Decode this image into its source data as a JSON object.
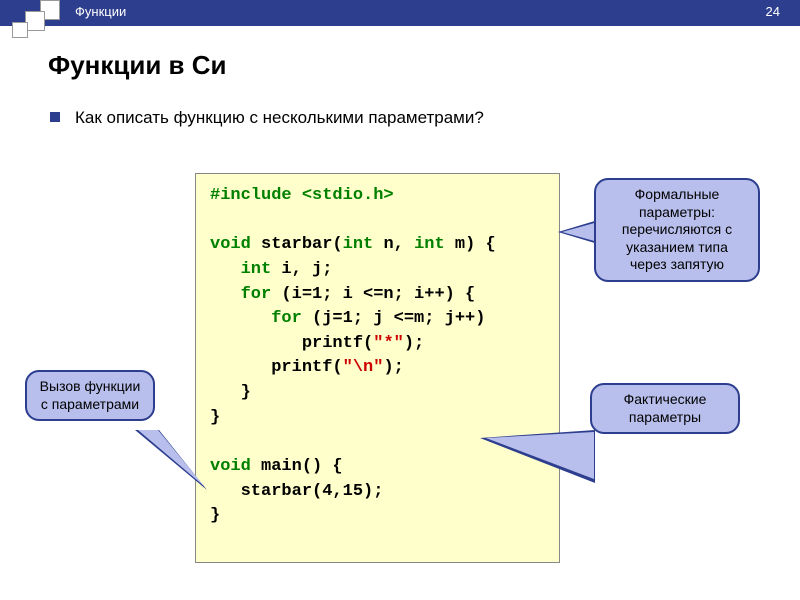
{
  "header": {
    "label": "Функции",
    "pageNumber": "24"
  },
  "title": "Функции в Си",
  "question": "Как описать функцию с несколькими параметрами?",
  "code": {
    "l1a": "#include <stdio.h>",
    "l2a": "void",
    "l2b": " starbar(",
    "l2c": "int",
    "l2d": " n, ",
    "l2e": "int",
    "l2f": " m)  {",
    "l3a": "int",
    "l3b": " i, j;",
    "l4a": "for",
    "l4b": " (i=1; i <=n; i++) {",
    "l5a": "for",
    "l5b": " (j=1; j <=m; j++)",
    "l6a": "printf(",
    "l6b": "\"*\"",
    "l6c": ");",
    "l7a": "printf(",
    "l7b": "\"\\n\"",
    "l7c": ");",
    "l8": "}",
    "l9": "}",
    "l10a": "void",
    "l10b": " main() {",
    "l11": "starbar(4,15);",
    "l12": "}"
  },
  "callouts": {
    "c1": "Формальные параметры: перечисляются с указанием типа через запятую",
    "c2": "Вызов функции с параметрами",
    "c3": "Фактические параметры"
  }
}
